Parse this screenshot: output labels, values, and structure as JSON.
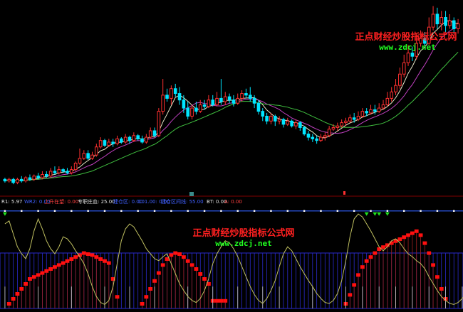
{
  "colors": {
    "background": "#000000",
    "candle_up": "#ff3030",
    "candle_down": "#00e5ff",
    "ma_short": "#e8e8c8",
    "ma_mid": "#c040c0",
    "ma_long": "#40c040",
    "divider": "#800000",
    "indicator_line": "#c0c060",
    "indicator_flat": "#3060ff",
    "grid_blue": "#2a2acc",
    "red_blocks": "#ff1010",
    "watermark_red": "#ff2020",
    "watermark_green": "#20ff20"
  },
  "watermarks": [
    {
      "title": "正点财经炒股指标公式网",
      "url": "www.zdcj.net"
    },
    {
      "title": "正点财经炒股指标公式网",
      "url": "www.zdcj.net"
    }
  ],
  "indicator_header": [
    {
      "text": "R1: 5.97",
      "color": "#e0e0e0"
    },
    {
      "text": "WR2: 0.00",
      "color": "#4060ff"
    },
    {
      "text": "上升在望: 0.00",
      "color": "#ff4040"
    },
    {
      "text": "专职庄血: 25.00",
      "color": "#e0e0e0"
    },
    {
      "text": "建仓区: 0.00",
      "color": "#4060ff"
    },
    {
      "text": "101.00: 0.00",
      "color": "#4060ff"
    },
    {
      "text": "建仓区间线: 55.00",
      "color": "#4060ff"
    },
    {
      "text": "BT: 0.00",
      "color": "#e0e0e0"
    },
    {
      "text": "A: 0.00",
      "color": "#ff4040"
    }
  ],
  "chart_data": {
    "type": "candlestick",
    "candles": [
      [
        14.6,
        14.5,
        14.7,
        14.4
      ],
      [
        14.5,
        14.6,
        14.7,
        14.4
      ],
      [
        14.6,
        14.4,
        14.7,
        14.3
      ],
      [
        14.4,
        14.6,
        14.7,
        14.3
      ],
      [
        14.6,
        14.5,
        14.8,
        14.4
      ],
      [
        14.5,
        14.7,
        14.8,
        14.4
      ],
      [
        14.7,
        14.6,
        14.9,
        14.5
      ],
      [
        14.6,
        14.8,
        14.9,
        14.5
      ],
      [
        14.8,
        14.7,
        15.0,
        14.6
      ],
      [
        14.7,
        14.9,
        15.1,
        14.6
      ],
      [
        14.9,
        14.8,
        15.1,
        14.7
      ],
      [
        14.8,
        15.1,
        15.3,
        14.7
      ],
      [
        15.1,
        15.0,
        15.4,
        14.9
      ],
      [
        15.0,
        15.2,
        15.4,
        14.9
      ],
      [
        15.2,
        15.1,
        15.3,
        15.0
      ],
      [
        15.1,
        15.0,
        15.3,
        14.9
      ],
      [
        15.0,
        15.2,
        15.4,
        14.9
      ],
      [
        15.2,
        15.6,
        15.7,
        15.1
      ],
      [
        15.6,
        15.9,
        16.5,
        15.5
      ],
      [
        15.9,
        16.2,
        16.4,
        15.8
      ],
      [
        16.2,
        15.9,
        16.4,
        15.8
      ],
      [
        15.9,
        16.1,
        16.3,
        15.8
      ],
      [
        16.1,
        16.6,
        16.8,
        16.0
      ],
      [
        16.6,
        17.0,
        17.2,
        16.5
      ],
      [
        17.0,
        16.7,
        17.1,
        16.6
      ],
      [
        16.7,
        16.9,
        17.1,
        16.6
      ],
      [
        16.9,
        16.8,
        17.1,
        16.6
      ],
      [
        16.8,
        17.1,
        17.3,
        16.7
      ],
      [
        17.1,
        16.9,
        17.2,
        16.8
      ],
      [
        16.9,
        17.2,
        17.4,
        16.8
      ],
      [
        17.2,
        17.0,
        17.3,
        16.8
      ],
      [
        17.0,
        17.3,
        17.5,
        16.9
      ],
      [
        17.3,
        17.1,
        17.4,
        17.0
      ],
      [
        17.1,
        16.9,
        17.3,
        16.8
      ],
      [
        16.9,
        17.2,
        17.4,
        16.8
      ],
      [
        17.2,
        17.6,
        17.8,
        17.1
      ],
      [
        17.6,
        17.3,
        17.8,
        17.2
      ],
      [
        17.3,
        18.8,
        19.0,
        17.2
      ],
      [
        18.8,
        19.8,
        20.8,
        18.6
      ],
      [
        19.8,
        19.6,
        20.2,
        19.4
      ],
      [
        19.6,
        20.2,
        20.4,
        19.2
      ],
      [
        20.2,
        19.9,
        20.5,
        19.7
      ],
      [
        19.9,
        19.5,
        20.3,
        19.2
      ],
      [
        19.5,
        19.0,
        19.8,
        18.7
      ],
      [
        19.0,
        18.5,
        19.4,
        18.3
      ],
      [
        18.5,
        19.0,
        19.2,
        18.3
      ],
      [
        19.0,
        18.8,
        19.4,
        18.6
      ],
      [
        18.8,
        19.2,
        19.5,
        18.7
      ],
      [
        19.2,
        19.1,
        19.5,
        18.9
      ],
      [
        19.1,
        19.5,
        19.8,
        19.0
      ],
      [
        19.5,
        19.2,
        19.8,
        19.1
      ],
      [
        19.2,
        19.6,
        20.0,
        19.1
      ],
      [
        19.6,
        19.4,
        20.8,
        19.2
      ],
      [
        19.4,
        19.7,
        20.0,
        19.2
      ],
      [
        19.7,
        19.5,
        19.9,
        19.3
      ],
      [
        19.5,
        19.3,
        19.8,
        19.1
      ],
      [
        19.3,
        19.6,
        19.9,
        19.2
      ],
      [
        19.6,
        19.9,
        20.1,
        19.4
      ],
      [
        19.9,
        19.8,
        20.2,
        19.6
      ],
      [
        19.8,
        19.6,
        20.3,
        19.4
      ],
      [
        19.6,
        19.3,
        19.8,
        19.0
      ],
      [
        19.3,
        18.8,
        19.5,
        18.6
      ],
      [
        18.8,
        18.5,
        19.0,
        18.2
      ],
      [
        18.5,
        18.2,
        18.7,
        18.0
      ],
      [
        18.2,
        18.5,
        18.7,
        18.0
      ],
      [
        18.5,
        18.2,
        18.6,
        17.9
      ],
      [
        18.2,
        18.3,
        18.5,
        18.0
      ],
      [
        18.3,
        18.0,
        18.4,
        17.8
      ],
      [
        18.0,
        18.2,
        18.4,
        17.9
      ],
      [
        18.2,
        17.9,
        18.3,
        17.8
      ],
      [
        17.9,
        18.1,
        18.3,
        17.7
      ],
      [
        18.1,
        17.8,
        18.2,
        17.6
      ],
      [
        17.8,
        17.4,
        17.9,
        17.3
      ],
      [
        17.4,
        17.2,
        17.6,
        17.0
      ],
      [
        17.2,
        17.1,
        17.4,
        16.9
      ],
      [
        17.1,
        17.0,
        17.3,
        16.8
      ],
      [
        17.0,
        17.2,
        17.4,
        16.9
      ],
      [
        17.2,
        17.3,
        17.5,
        17.0
      ],
      [
        17.3,
        17.7,
        17.9,
        17.2
      ],
      [
        17.7,
        17.8,
        18.0,
        17.6
      ],
      [
        17.8,
        17.9,
        18.1,
        17.6
      ],
      [
        17.9,
        18.1,
        18.3,
        17.8
      ],
      [
        18.1,
        18.2,
        18.4,
        17.9
      ],
      [
        18.2,
        18.4,
        18.6,
        18.1
      ],
      [
        18.4,
        18.3,
        18.7,
        18.1
      ],
      [
        18.3,
        18.5,
        18.8,
        18.2
      ],
      [
        18.5,
        18.8,
        19.0,
        18.4
      ],
      [
        18.8,
        18.7,
        19.0,
        18.5
      ],
      [
        18.7,
        18.9,
        19.2,
        18.6
      ],
      [
        18.9,
        18.8,
        19.2,
        18.6
      ],
      [
        18.8,
        19.0,
        19.3,
        18.7
      ],
      [
        19.0,
        19.2,
        19.5,
        18.9
      ],
      [
        19.2,
        19.6,
        20.0,
        19.1
      ],
      [
        19.6,
        20.0,
        20.3,
        19.4
      ],
      [
        20.0,
        20.4,
        20.8,
        19.8
      ],
      [
        20.4,
        21.1,
        21.5,
        20.2
      ],
      [
        21.1,
        21.8,
        22.3,
        20.9
      ],
      [
        21.8,
        22.4,
        22.9,
        21.6
      ],
      [
        22.4,
        22.2,
        22.8,
        21.9
      ],
      [
        22.2,
        23.0,
        23.6,
        22.0
      ],
      [
        23.0,
        23.3,
        23.8,
        22.8
      ],
      [
        23.3,
        23.0,
        23.7,
        22.7
      ],
      [
        23.0,
        24.0,
        24.6,
        22.9
      ],
      [
        24.0,
        24.8,
        25.3,
        23.8
      ],
      [
        24.8,
        24.2,
        25.2,
        23.9
      ],
      [
        24.2,
        24.6,
        25.0,
        23.8
      ],
      [
        24.6,
        24.1,
        25.0,
        23.7
      ],
      [
        24.1,
        24.4,
        24.8,
        23.9
      ],
      [
        24.4,
        23.9,
        24.6,
        23.6
      ],
      [
        23.9,
        24.2,
        24.5,
        23.6
      ]
    ],
    "ylim": [
      14.0,
      25.5
    ],
    "ma_periods": [
      5,
      10,
      20
    ],
    "indicator": {
      "ylim": [
        0,
        100
      ],
      "line": [
        85,
        88,
        75,
        62,
        55,
        50,
        60,
        78,
        90,
        80,
        68,
        60,
        55,
        62,
        72,
        70,
        65,
        58,
        52,
        45,
        35,
        22,
        12,
        6,
        4,
        8,
        22,
        45,
        68,
        80,
        85,
        82,
        75,
        68,
        60,
        55,
        50,
        48,
        52,
        55,
        45,
        35,
        25,
        18,
        12,
        8,
        6,
        10,
        18,
        30,
        45,
        55,
        62,
        68,
        66,
        60,
        52,
        42,
        32,
        22,
        14,
        8,
        5,
        10,
        18,
        28,
        42,
        55,
        62,
        58,
        50,
        42,
        35,
        28,
        22,
        15,
        10,
        6,
        5,
        8,
        15,
        28,
        48,
        72,
        90,
        95,
        92,
        85,
        78,
        70,
        62,
        58,
        62,
        68,
        70,
        66,
        60,
        55,
        52,
        48,
        45,
        40,
        32,
        25,
        18,
        12,
        8,
        5,
        4,
        6,
        10,
        15
      ],
      "flat_level": 98,
      "red_bars": [
        0,
        5,
        10,
        15,
        20,
        25,
        30,
        32,
        34,
        36,
        38,
        40,
        42,
        44,
        46,
        48,
        50,
        52,
        54,
        56,
        55,
        54,
        52,
        50,
        48,
        46,
        30,
        12,
        0,
        0,
        0,
        0,
        0,
        5,
        12,
        20,
        28,
        36,
        44,
        50,
        54,
        56,
        55,
        52,
        48,
        44,
        40,
        35,
        30,
        25,
        8,
        8,
        8,
        8,
        0,
        0,
        0,
        0,
        0,
        0,
        0,
        0,
        0,
        0,
        0,
        0,
        0,
        0,
        0,
        0,
        0,
        0,
        0,
        0,
        0,
        0,
        0,
        0,
        0,
        0,
        0,
        0,
        5,
        14,
        24,
        34,
        42,
        48,
        52,
        56,
        60,
        62,
        64,
        66,
        68,
        70,
        72,
        74,
        76,
        78,
        74,
        66,
        56,
        44,
        32,
        20,
        10,
        0,
        0,
        0,
        0,
        0
      ],
      "green_arrows_at": [
        0,
        87,
        89,
        90,
        92
      ],
      "white_markers_at": [
        0,
        8,
        16,
        24,
        30,
        36,
        44,
        50,
        56,
        62,
        66,
        74,
        82,
        86,
        90,
        94,
        98,
        102,
        106,
        110
      ]
    }
  }
}
